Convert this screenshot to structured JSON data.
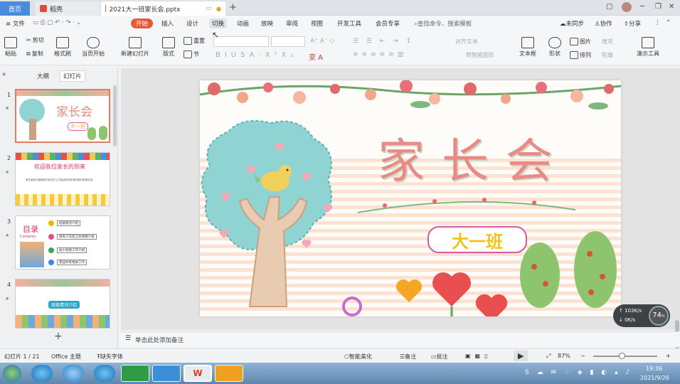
{
  "titlebar": {
    "home": "首页",
    "dk": "稻壳",
    "file": "2021大一班家长会.pptx"
  },
  "menu": {
    "file": "文件",
    "items": [
      "开始",
      "插入",
      "设计",
      "切换",
      "动画",
      "放映",
      "审阅",
      "视图",
      "开发工具",
      "会员专享"
    ],
    "search": "查找命令、搜索模板",
    "sync": "未同步",
    "collab": "协作",
    "share": "分享"
  },
  "toolbar": {
    "paste": "粘贴",
    "cut": "剪切",
    "copy": "复制",
    "format": "格式刷",
    "from_current": "当页开始",
    "new_slide": "新建幻灯片",
    "layout": "版式",
    "section": "节",
    "reset": "重置",
    "text_dir": "对齐文本",
    "smart": "转智能图形",
    "textbox": "文本框",
    "shape": "形状",
    "picture": "图片",
    "arrange": "排列",
    "fill": "填充",
    "outline": "轮廓",
    "present_tool": "演示工具"
  },
  "leftpane": {
    "outline_tab": "大纲",
    "slides_tab": "幻灯片",
    "slide_nums": [
      "1",
      "2",
      "3",
      "4"
    ],
    "thumb1": {
      "title": "家长会",
      "badge": "大一班"
    },
    "thumb2": {
      "title": "欢迎各位家长的到来",
      "body": "家长朋友们感谢你们在百忙之中抽出时间来参加我们的家长会"
    },
    "thumb3": {
      "title": "目录",
      "sub": "Contents",
      "items": [
        "班级情况介绍",
        "保育工作及卫生保健介绍",
        "幼小衔接工作介绍",
        "家园共育相关工作"
      ]
    },
    "thumb4": {
      "title": "班级情况介绍"
    }
  },
  "slide": {
    "title": "家长会",
    "class_badge": "大一班"
  },
  "notes": {
    "placeholder": "单击此处添加备注"
  },
  "status": {
    "slide_pos": "幻灯片 1 / 21",
    "theme": "Office 主题",
    "missing_font": "缺失字体",
    "beautify": "智能美化",
    "notes": "备注",
    "comment": "批注",
    "zoom": "87%"
  },
  "netwidget": {
    "up": "103",
    "up_unit": "K/s",
    "down": "0",
    "down_unit": "K/s",
    "pct": "74",
    "pct_unit": "%"
  },
  "taskbar": {
    "time": "19:36",
    "date": "2021/9/26"
  }
}
